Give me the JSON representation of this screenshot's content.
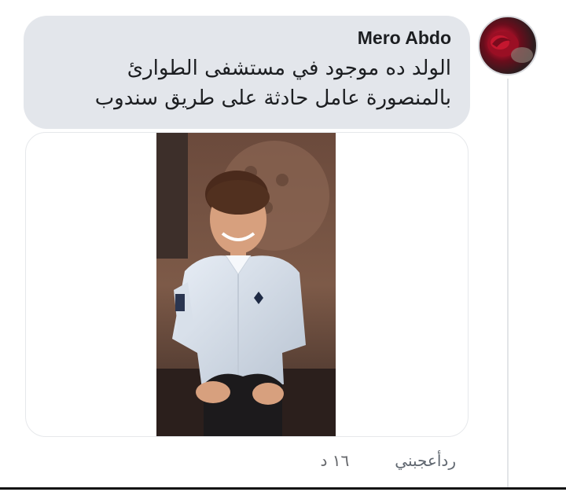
{
  "comment": {
    "author": "Mero Abdo",
    "text_line1": "الولد ده موجود في مستشفى الطوارئ",
    "text_line2": "بالمنصورة عامل حادثة على طريق سندوب",
    "photo_label": "photo-of-boy-in-white-shirt"
  },
  "actions": {
    "time": "١٦ د",
    "like": "أعجبني",
    "reply": "رد"
  },
  "colors": {
    "bubble": "#e3e6eb",
    "text": "#1c1e21",
    "meta": "#65676b"
  }
}
